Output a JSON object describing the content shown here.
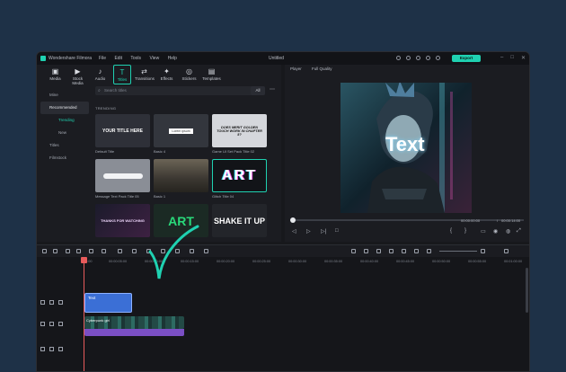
{
  "app": {
    "name": "Wondershare Filmora",
    "menu": [
      "File",
      "Edit",
      "Tools",
      "View",
      "Help"
    ],
    "project": "Untitled",
    "export": "Export",
    "accent": "#1fd1b1"
  },
  "toolbar": [
    {
      "label": "Media",
      "icon": "media-icon"
    },
    {
      "label": "Stock Media",
      "icon": "stock-media-icon"
    },
    {
      "label": "Audio",
      "icon": "audio-icon"
    },
    {
      "label": "Titles",
      "icon": "titles-icon",
      "active": true
    },
    {
      "label": "Transitions",
      "icon": "transitions-icon"
    },
    {
      "label": "Effects",
      "icon": "effects-icon"
    },
    {
      "label": "Stickers",
      "icon": "stickers-icon"
    },
    {
      "label": "Templates",
      "icon": "templates-icon"
    }
  ],
  "sidebar": {
    "mine": "Mine",
    "recommended": "Recommended",
    "trending": "Trending",
    "new": "New",
    "titles": "Titles",
    "filmstock": "Filmstock"
  },
  "search": {
    "placeholder": "Search titles",
    "filter": "All"
  },
  "section_label": "TRENDING",
  "thumbs": [
    {
      "caption": "Default Title",
      "text": "YOUR TITLE HERE"
    },
    {
      "caption": "Basic 4",
      "text": "Lorem ipsum"
    },
    {
      "caption": "Game UI Set Pack Title 02",
      "text": "DOES MERIT GOLDEN TOUCH WORK IN CHAPTER 5?"
    },
    {
      "caption": "Message Text Pack Title 05",
      "text": ""
    },
    {
      "caption": "Basic 1",
      "text": ""
    },
    {
      "caption": "Glitch Title 04",
      "text": "ART"
    },
    {
      "caption": "",
      "text": "THANKS FOR WATCHING"
    },
    {
      "caption": "",
      "text": "ART"
    },
    {
      "caption": "",
      "text": "SHAKE IT UP"
    }
  ],
  "player": {
    "label": "Player",
    "quality": "Full Quality",
    "preview_text": "Text",
    "current_time": "00:00:00:00",
    "total_time": "00:00:14:00",
    "separator": "/"
  },
  "timeline": {
    "ruler": [
      "00:00",
      "00:00:05:00",
      "00:00:10:00",
      "00:00:15:00",
      "00:00:20:00",
      "00:00:25:00",
      "00:00:30:00",
      "00:00:35:00",
      "00:00:40:00",
      "00:00:45:00",
      "00:00:50:00",
      "00:00:55:00",
      "00:01:00:00"
    ],
    "title_clip": "Text",
    "video_clip": "Cyberpunk girl"
  }
}
